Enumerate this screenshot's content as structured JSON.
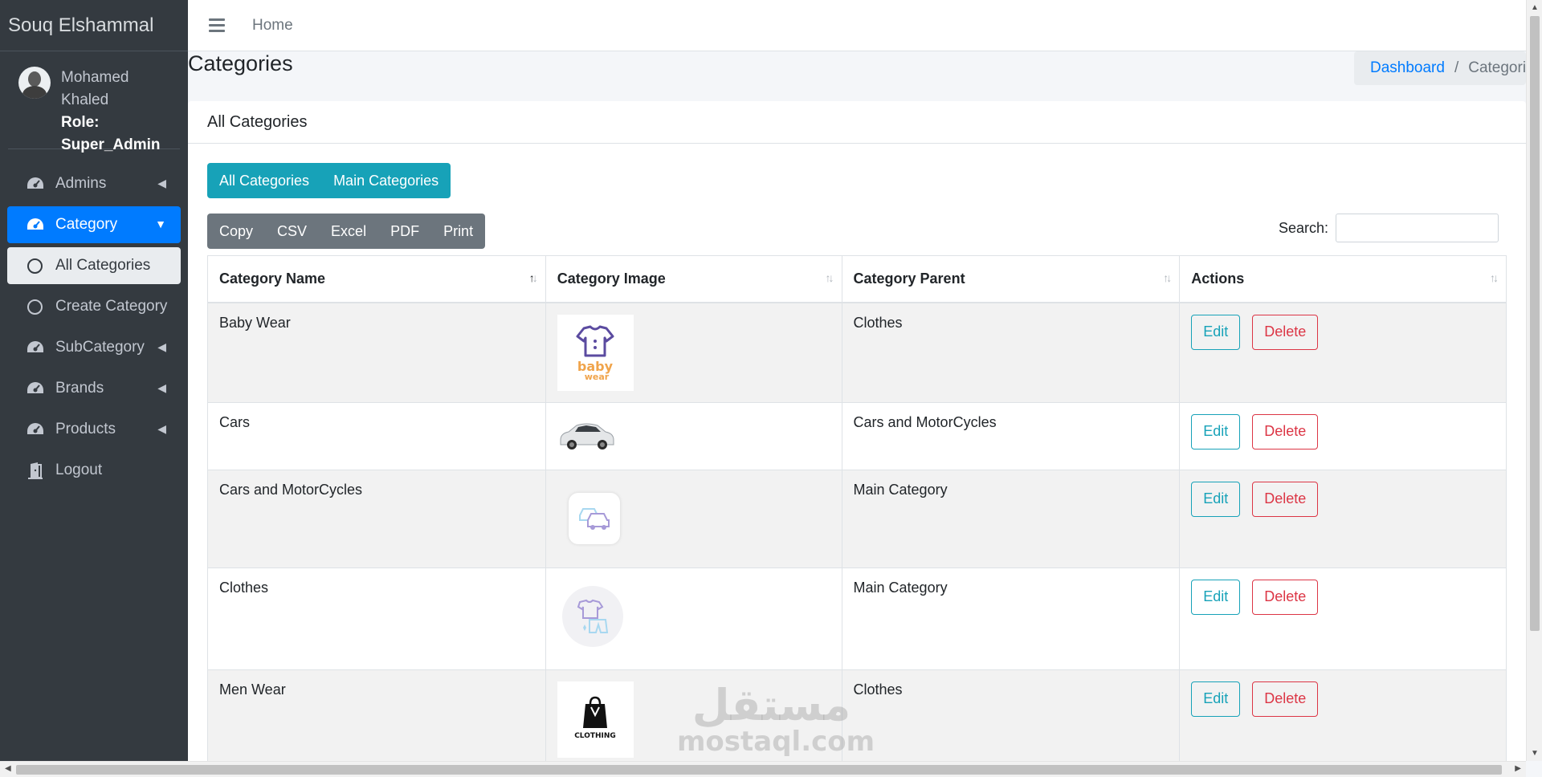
{
  "sidebar": {
    "brand": "Souq Elshammal",
    "user": {
      "name": "Mohamed Khaled",
      "role": "Role: Super_Admin"
    },
    "items": [
      {
        "label": "Admins",
        "icon": "gauge-icon"
      },
      {
        "label": "Category",
        "icon": "gauge-icon",
        "active": true
      },
      {
        "label": "All Categories",
        "icon": "circle-icon",
        "sub": true
      },
      {
        "label": "Create Category",
        "icon": "circle-icon",
        "sub": true
      },
      {
        "label": "SubCategory",
        "icon": "gauge-icon"
      },
      {
        "label": "Brands",
        "icon": "gauge-icon"
      },
      {
        "label": "Products",
        "icon": "gauge-icon"
      },
      {
        "label": "Logout",
        "icon": "door-icon"
      }
    ]
  },
  "topbar": {
    "home": "Home"
  },
  "header": {
    "title": "Categories",
    "breadcrumb": {
      "link": "Dashboard",
      "separator": "/",
      "current": "Categories"
    }
  },
  "card": {
    "title": "All Categories",
    "filters": [
      "All Categories",
      "Main Categories"
    ],
    "exports": [
      "Copy",
      "CSV",
      "Excel",
      "PDF",
      "Print"
    ],
    "search_label": "Search:",
    "search_value": ""
  },
  "table": {
    "columns": [
      "Category Name",
      "Category Image",
      "Category Parent",
      "Actions"
    ],
    "rows": [
      {
        "name": "Baby Wear",
        "image": "baby-wear-logo",
        "parent": "Clothes"
      },
      {
        "name": "Cars",
        "image": "car-photo",
        "parent": "Cars and MotorCycles"
      },
      {
        "name": "Cars and MotorCycles",
        "image": "cars-icon",
        "parent": "Main Category"
      },
      {
        "name": "Clothes",
        "image": "clothes-icon",
        "parent": "Main Category"
      },
      {
        "name": "Men Wear",
        "image": "clothing-logo",
        "parent": "Clothes"
      }
    ],
    "edit_label": "Edit",
    "delete_label": "Delete"
  },
  "images": {
    "baby_text_1": "baby",
    "baby_text_2": "wear",
    "clothing_text": "CLOTHING"
  },
  "watermark": {
    "arabic": "مستقل",
    "latin": "mostaql.com"
  },
  "colors": {
    "primary": "#007bff",
    "info": "#17a2b8",
    "danger": "#dc3545",
    "sidebar": "#343a40"
  }
}
